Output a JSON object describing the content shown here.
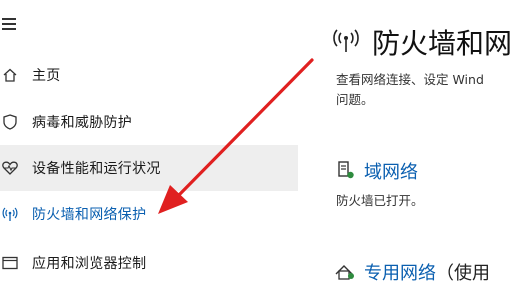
{
  "sidebar": {
    "items": [
      {
        "label": "主页",
        "icon": "home-icon"
      },
      {
        "label": "病毒和威胁防护",
        "icon": "shield-icon"
      },
      {
        "label": "设备性能和运行状况",
        "icon": "heart-icon"
      },
      {
        "label": "防火墙和网络保护",
        "icon": "wifi-antenna-icon"
      },
      {
        "label": "应用和浏览器控制",
        "icon": "app-window-icon"
      }
    ]
  },
  "main": {
    "title": "防火墙和网",
    "description_line1": "查看网络连接、设定 Wind",
    "description_line2": "问题。",
    "domain_network": {
      "label": "域网络",
      "status": "防火墙已打开。"
    },
    "private_network": {
      "label": "专用网络",
      "extra": "（使用"
    }
  },
  "colors": {
    "accent": "#0a5fb0",
    "hover_bg": "#eeeeee",
    "arrow": "#e02020"
  }
}
